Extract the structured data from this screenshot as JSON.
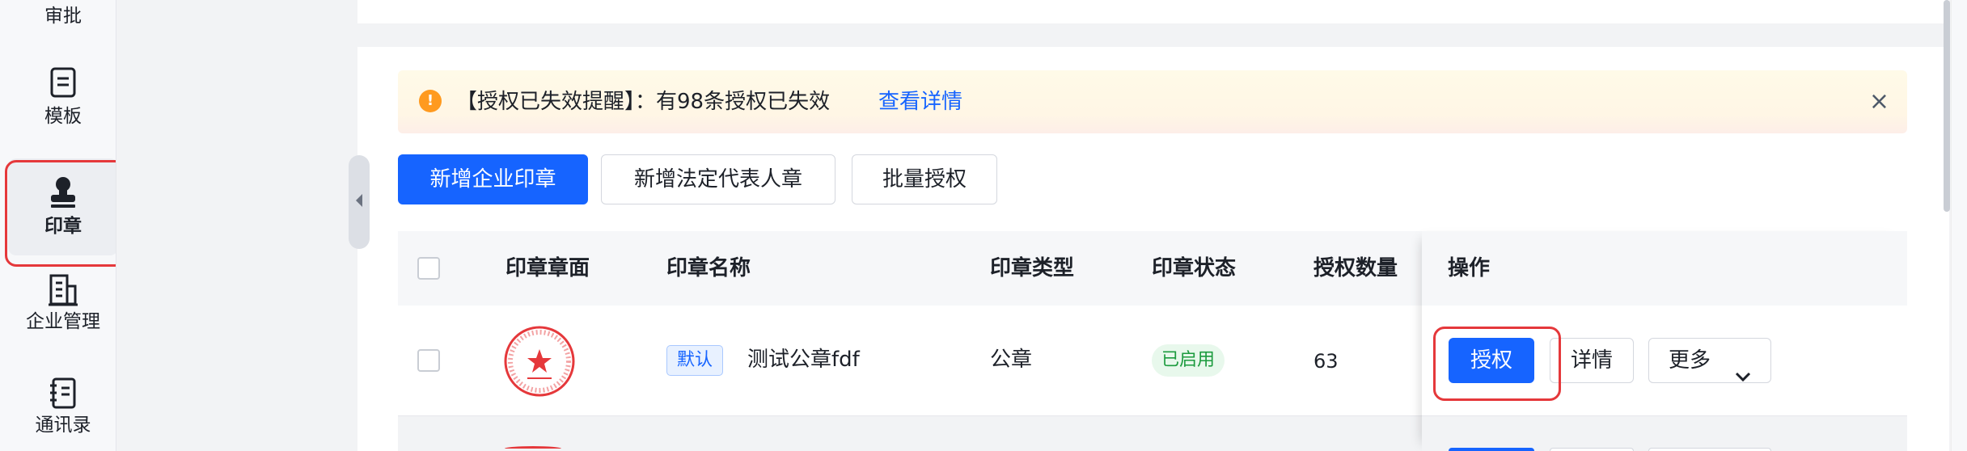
{
  "sidebar": {
    "items": [
      {
        "label": "审批",
        "icon": "approval-icon"
      },
      {
        "label": "模板",
        "icon": "template-icon"
      },
      {
        "label": "印章",
        "icon": "seal-icon",
        "active": true
      },
      {
        "label": "企业管理",
        "icon": "building-icon"
      },
      {
        "label": "通讯录",
        "icon": "contacts-icon"
      }
    ]
  },
  "alert": {
    "text": "【授权已失效提醒】：有98条授权已失效",
    "link": "查看详情",
    "close": "×"
  },
  "toolbar": {
    "add_company_seal": "新增企业印章",
    "add_legal_rep_seal": "新增法定代表人章",
    "batch_authorize": "批量授权"
  },
  "table": {
    "columns": [
      "印章章面",
      "印章名称",
      "印章类型",
      "印章状态",
      "授权数量",
      "操作"
    ],
    "rows": [
      {
        "default_tag": "默认",
        "name": "测试公章fdf",
        "type": "公章",
        "status": "已启用",
        "auth_count": "63",
        "actions": {
          "authorize": "授权",
          "details": "详情",
          "more": "更多"
        }
      }
    ]
  },
  "colors": {
    "primary": "#1664ff",
    "alert_icon": "#ff9a1f",
    "highlight": "#e5383b",
    "status_enabled": "#1c9b3e"
  }
}
